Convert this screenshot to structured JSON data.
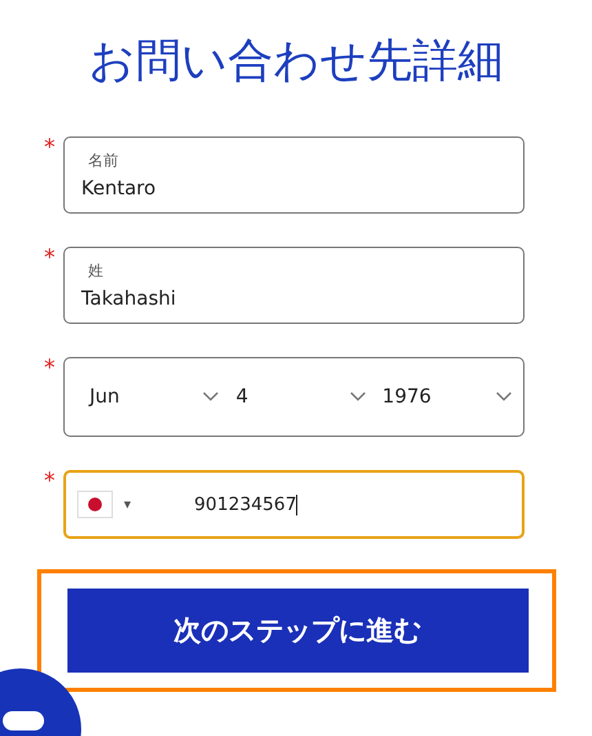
{
  "title": "お問い合わせ先詳細",
  "fields": [
    {
      "kind": "text",
      "label": "名前",
      "value": "Kentaro",
      "required": true,
      "focused": false
    },
    {
      "kind": "text",
      "label": "姓",
      "value": "Takahashi",
      "required": true,
      "focused": false
    },
    {
      "kind": "date",
      "required": true,
      "focused": false,
      "selects": [
        "Jun",
        "4",
        "1976"
      ]
    },
    {
      "kind": "phone",
      "required": true,
      "focused": true,
      "value": "901234567",
      "country_menu": "▾"
    }
  ],
  "required_mark": "*",
  "next_button": {
    "label": "次のステップに進む",
    "highlighted": true
  }
}
